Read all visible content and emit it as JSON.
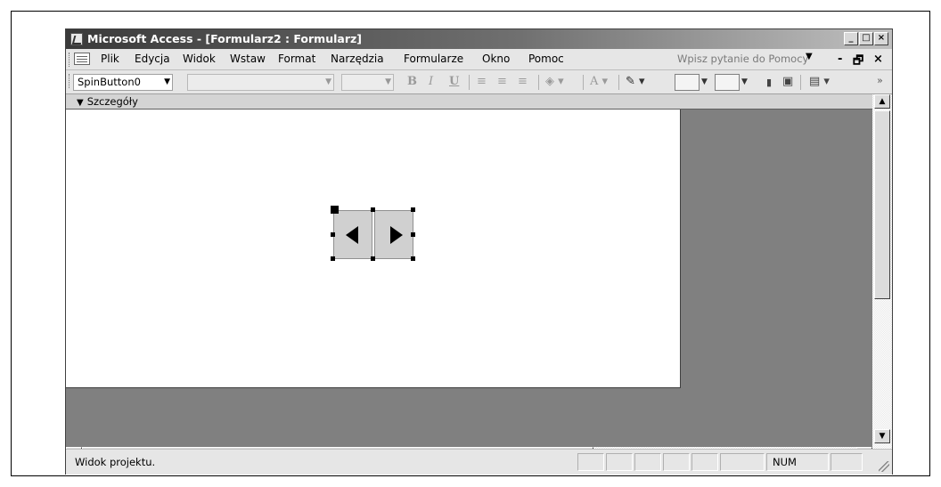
{
  "window": {
    "title": "Microsoft Access - [Formularz2 : Formularz]",
    "controls": [
      "_",
      "□",
      "×"
    ]
  },
  "menubar": {
    "items": [
      "Plik",
      "Edycja",
      "Widok",
      "Wstaw",
      "Format",
      "Narzędzia",
      "Formularze",
      "Okno",
      "Pomoc"
    ],
    "help_placeholder": "Wpisz pytanie do Pomocy",
    "mdi_controls": [
      "-",
      "🗗",
      "×"
    ]
  },
  "toolbar": {
    "object_combo": "SpinButton0",
    "bold": "B",
    "italic": "I",
    "underline": "U",
    "font_color": "A"
  },
  "designer": {
    "section_label": "Szczegóły",
    "control": "spin-button"
  },
  "statusbar": {
    "text": "Widok projektu.",
    "num": "NUM"
  },
  "colors": {
    "title_gradient_start": "#3a3a3a",
    "form_background": "#ffffff",
    "workspace": "#808080"
  }
}
